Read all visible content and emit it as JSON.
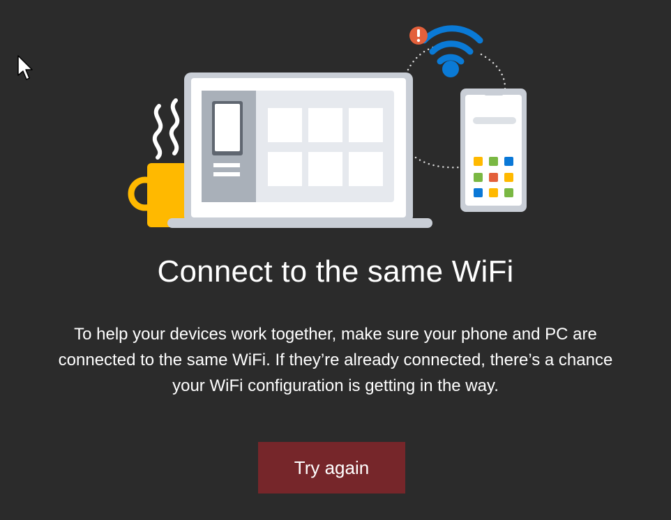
{
  "dialog": {
    "title": "Connect to the same WiFi",
    "description_lines": [
      "To help your devices work together, make sure your phone and PC are",
      "connected to the same WiFi. If they’re already connected, there’s a chance",
      "your WiFi configuration is getting in the way."
    ],
    "primary_button_label": "Try again"
  },
  "illustration": {
    "icons": [
      "coffee-mug-icon",
      "steam-icon",
      "laptop-icon",
      "wifi-icon",
      "warning-badge-icon",
      "phone-icon"
    ],
    "colors": {
      "background": "#2b2b2b",
      "button": "#76262a",
      "wifi": "#0a7ad6",
      "warning": "#e3603b",
      "mug": "#ffb900",
      "laptop_frame": "#c9ced6",
      "laptop_screen": "#e6e9ee",
      "laptop_sidebar": "#a9b0b9",
      "app_tiles": [
        "#ffb900",
        "#7ab843",
        "#0a78d7",
        "#7ab843",
        "#e3603b",
        "#ffb900",
        "#0a78d7",
        "#ffb900",
        "#7ab843"
      ]
    }
  }
}
